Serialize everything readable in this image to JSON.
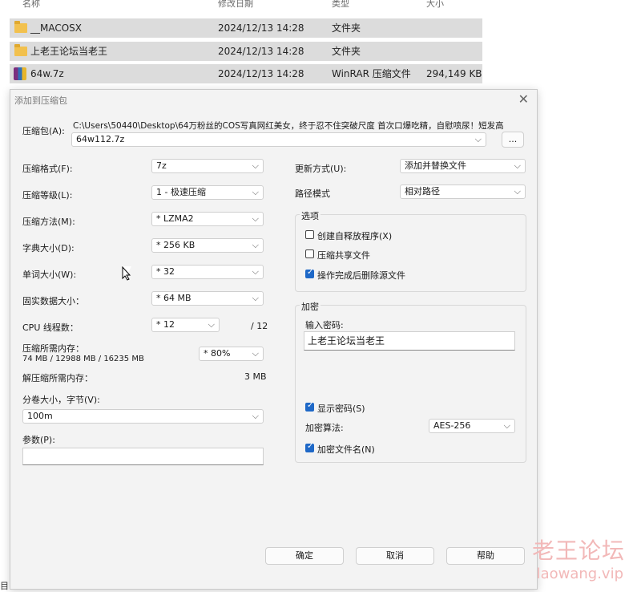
{
  "explorer": {
    "columns": {
      "name": "名称",
      "modified": "修改日期",
      "type": "类型",
      "size": "大小"
    },
    "rows": [
      {
        "name": "__MACOSX",
        "modified": "2024/12/13 14:28",
        "type": "文件夹",
        "size": "",
        "icon": "folder-icon"
      },
      {
        "name": "上老王论坛当老王",
        "modified": "2024/12/13 14:28",
        "type": "文件夹",
        "size": "",
        "icon": "folder-icon"
      },
      {
        "name": "64w.7z",
        "modified": "2024/12/13 14:28",
        "type": "WinRAR 压缩文件",
        "size": "294,149 KB",
        "icon": "winrar-icon"
      }
    ],
    "bottom_fragment": "目"
  },
  "dialog": {
    "title": "添加到压缩包",
    "archive_label": "压缩包(A):",
    "archive_path": "C:\\Users\\50440\\Desktop\\64万粉丝的COS写真网红美女，终于忍不住突破尺度 首次口爆吃精，自慰喷尿！短发高",
    "archive_name": "64w112.7z",
    "browse_label": "...",
    "left": {
      "format_label": "压缩格式(F):",
      "format_value": "7z",
      "level_label": "压缩等级(L):",
      "level_value": "1 - 极速压缩",
      "method_label": "压缩方法(M):",
      "method_value": "* LZMA2",
      "dict_label": "字典大小(D):",
      "dict_value": "* 256 KB",
      "word_label": "单词大小(W):",
      "word_value": "* 32",
      "solid_label": "固实数据大小：",
      "solid_value": "* 64 MB",
      "cpu_label": "CPU 线程数：",
      "cpu_value": "* 12",
      "cpu_max": "/ 12",
      "mem_label": "压缩所需内存：",
      "mem_detail": "74 MB / 12988 MB / 16235 MB",
      "mem_value": "* 80%",
      "decomp_label": "解压缩所需内存：",
      "decomp_value": "3 MB",
      "volume_label": "分卷大小，字节(V):",
      "volume_value": "100m",
      "params_label": "参数(P):",
      "params_value": ""
    },
    "right": {
      "update_label": "更新方式(U):",
      "update_value": "添加并替换文件",
      "path_label": "路径模式",
      "path_value": "相对路径",
      "options_title": "选项",
      "options": [
        {
          "label": "创建自释放程序(X)",
          "checked": false
        },
        {
          "label": "压缩共享文件",
          "checked": false
        },
        {
          "label": "操作完成后删除源文件",
          "checked": true
        }
      ],
      "encrypt_title": "加密",
      "password_label": "输入密码:",
      "password_value": "上老王论坛当老王",
      "show_password_label": "显示密码(S)",
      "show_password_checked": true,
      "enc_method_label": "加密算法:",
      "enc_method_value": "AES-256",
      "encrypt_names_label": "加密文件名(N)",
      "encrypt_names_checked": true
    },
    "buttons": {
      "ok": "确定",
      "cancel": "取消",
      "help": "帮助"
    }
  },
  "watermark": {
    "line1": "老王论坛",
    "line2": "laowang.vip"
  }
}
